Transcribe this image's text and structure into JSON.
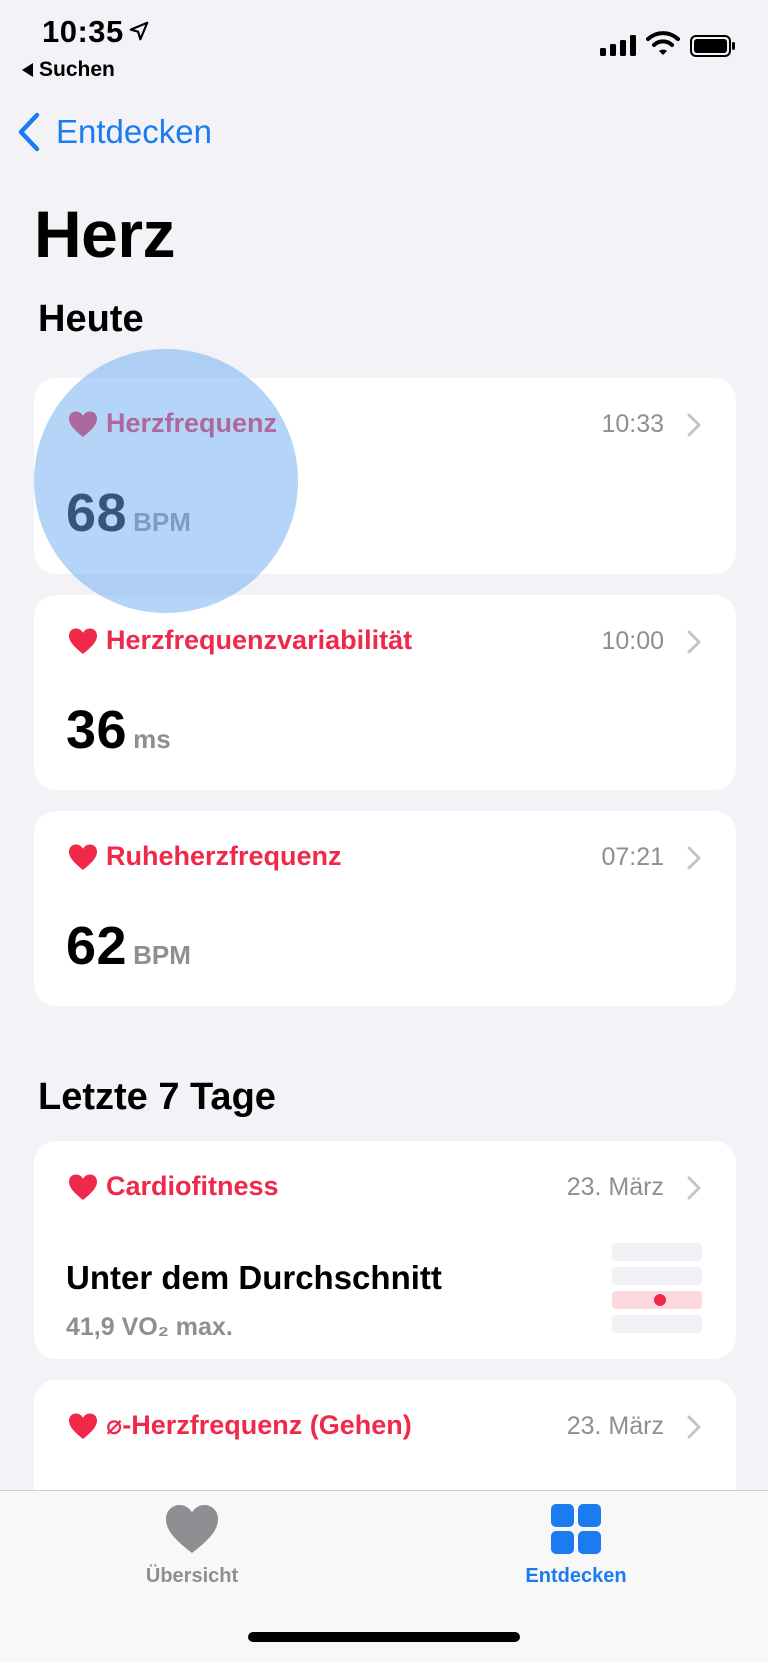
{
  "status_bar": {
    "time": "10:35",
    "back_app": "Suchen"
  },
  "nav": {
    "back_label": "Entdecken"
  },
  "page_title": "Herz",
  "sections": {
    "today_title": "Heute",
    "last7_title": "Letzte 7 Tage"
  },
  "cards": [
    {
      "label": "Herzfrequenz",
      "time": "10:33",
      "value": "68",
      "unit": "BPM",
      "icon": "heart-icon"
    },
    {
      "label": "Herzfrequenzvariabilität",
      "time": "10:00",
      "value": "36",
      "unit": "ms",
      "icon": "heart-icon"
    },
    {
      "label": "Ruheherzfrequenz",
      "time": "07:21",
      "value": "62",
      "unit": "BPM",
      "icon": "heart-icon"
    }
  ],
  "cardio": {
    "label": "Cardiofitness",
    "date": "23. März",
    "status": "Unter dem Durchschnitt",
    "detail": "41,9 VO₂ max.",
    "icon": "heart-icon"
  },
  "walking": {
    "label": "⌀-Herzfrequenz (Gehen)",
    "date": "23. März",
    "icon": "heart-icon"
  },
  "tab_bar": {
    "tabs": [
      {
        "label": "Übersicht",
        "icon": "heart-icon",
        "active": false
      },
      {
        "label": "Entdecken",
        "icon": "grid-icon",
        "active": true
      }
    ]
  },
  "colors": {
    "accent": "#1a7cf0",
    "heart": "#f0284a",
    "secondary_text": "#8e8e93",
    "background": "#f2f2f7",
    "tab_inactive": "#8e8e93"
  }
}
